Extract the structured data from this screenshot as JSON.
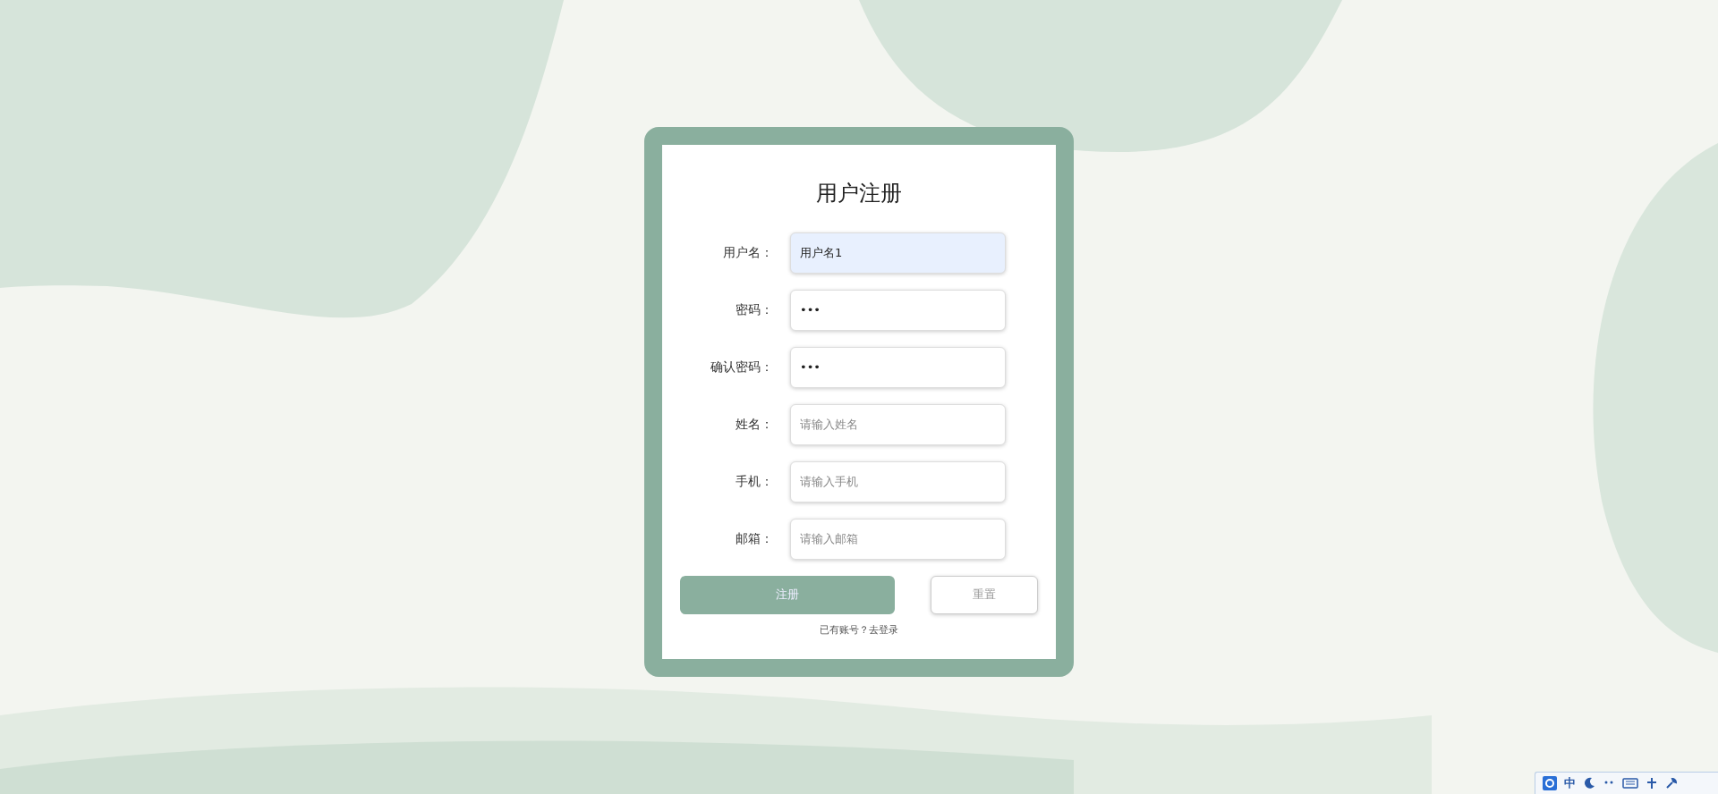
{
  "form": {
    "title": "用户注册",
    "fields": [
      {
        "label": "用户名：",
        "value": "用户名1",
        "autofilled": true
      },
      {
        "label": "密码：",
        "value": "•••",
        "autofilled": false
      },
      {
        "label": "确认密码：",
        "value": "•••",
        "autofilled": false
      },
      {
        "label": "姓名：",
        "placeholder": "请输入姓名",
        "autofilled": false
      },
      {
        "label": "手机：",
        "placeholder": "请输入手机",
        "autofilled": false
      },
      {
        "label": "邮箱：",
        "placeholder": "请输入邮箱",
        "autofilled": false
      }
    ],
    "buttons": [
      {
        "label": "注册",
        "kind": "primary"
      },
      {
        "label": "重置",
        "kind": "secondary"
      }
    ],
    "footer_link": "已有账号？去登录"
  },
  "ime_bar": {
    "mode": "中"
  }
}
